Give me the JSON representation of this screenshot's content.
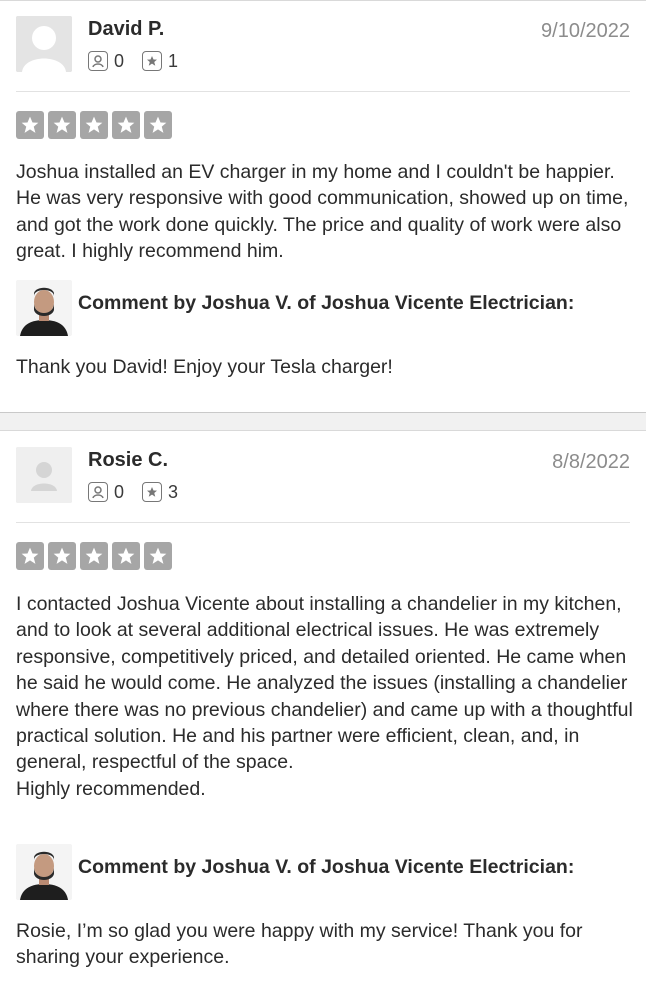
{
  "reviews": [
    {
      "name": "David P.",
      "date": "9/10/2022",
      "friends_count": "0",
      "reviews_count": "1",
      "rating": 5,
      "text": "Joshua installed an EV charger in my home and I couldn't be happier. He was very responsive with good communication, showed up on time, and got the work done quickly. The price and quality of work were also great. I highly recommend him.",
      "comment_title": "Comment by Joshua V. of Joshua Vicente Electrician:",
      "comment_text": "Thank you David! Enjoy your Tesla charger!"
    },
    {
      "name": "Rosie C.",
      "date": "8/8/2022",
      "friends_count": "0",
      "reviews_count": "3",
      "rating": 5,
      "text": "I contacted Joshua Vicente about installing a chandelier in my kitchen, and to look at several additional electrical issues. He was extremely responsive, competitively priced, and detailed oriented. He came when he said he would come. He analyzed the issues (installing a chandelier where there was no previous chandelier) and came up with a thoughtful practical solution. He and his partner were efficient, clean, and, in general, respectful of the space.\nHighly recommended.",
      "comment_title": "Comment by Joshua V. of Joshua Vicente Electrician:",
      "comment_text": "Rosie, I’m so glad you were happy with my service! Thank you for sharing your experience."
    }
  ],
  "icons": {
    "friends": "friends-icon",
    "reviews": "review-count-icon",
    "star": "star-icon",
    "avatar": "default-avatar-icon"
  },
  "colors": {
    "star_fill": "#a6a6a6",
    "date_text": "#8c8c8c",
    "body_text": "#2b2b2b"
  }
}
